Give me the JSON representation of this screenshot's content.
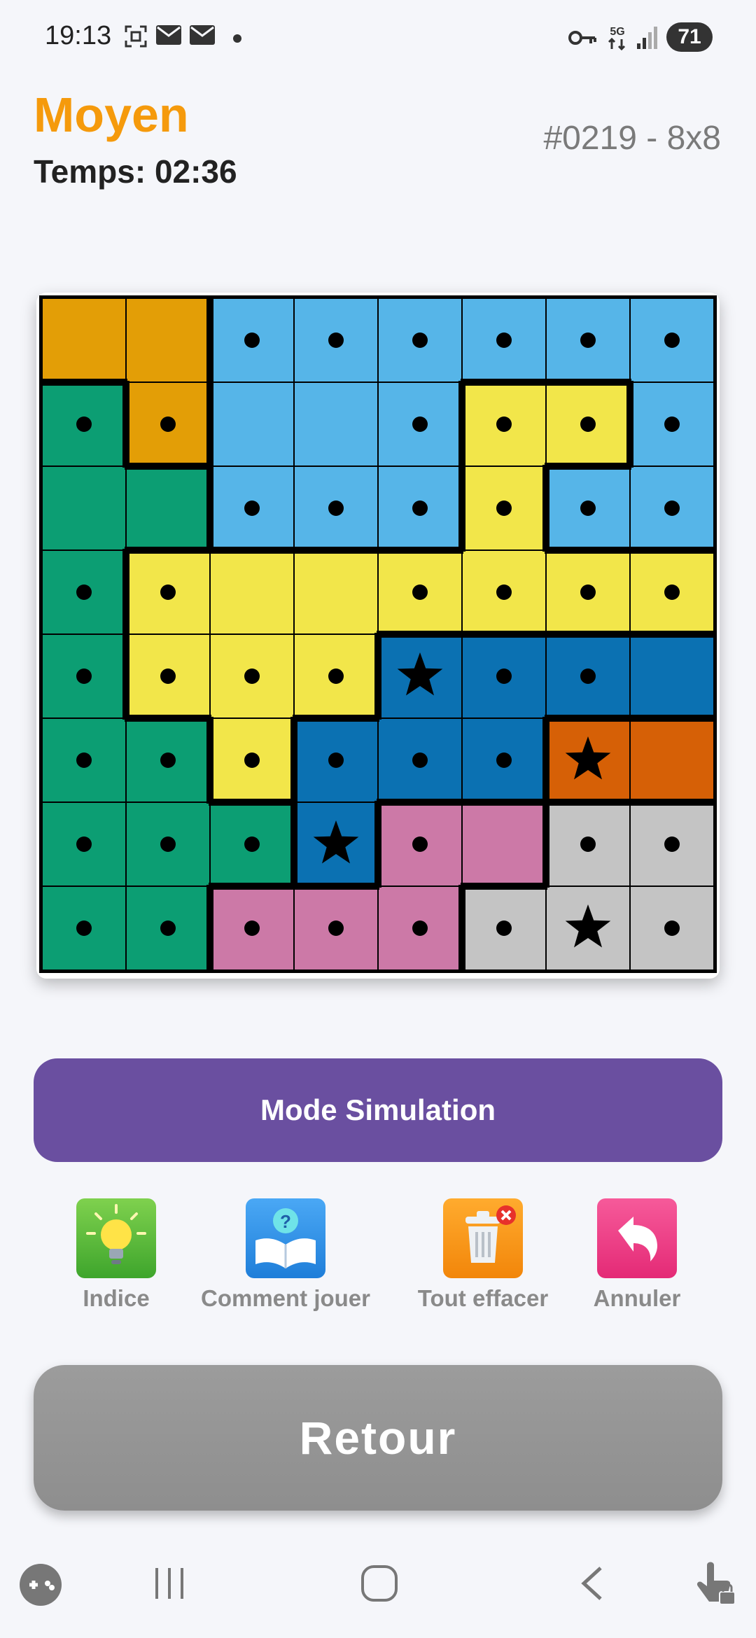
{
  "status_bar": {
    "time": "19:13",
    "battery": "71",
    "network": "5G"
  },
  "header": {
    "difficulty": "Moyen",
    "timer": "Temps: 02:36",
    "puzzle_id": "#0219 - 8x8"
  },
  "board": {
    "size": 8,
    "colors": {
      "O": "#e39e06",
      "L": "#56b5e8",
      "G": "#0c9e73",
      "Y": "#f2e64a",
      "B": "#0b71b2",
      "R": "#d66006",
      "P": "#cc79a7",
      "S": "#c4c4c4"
    },
    "regions": [
      "OOLLLLLL",
      "GOLLLYYL",
      "GGLLLYLL",
      "GYYYYYYY",
      "GYYYBBBB",
      "GGYBBBRR",
      "GGGBPPSS",
      "GGPPPSSS"
    ],
    "marks": [
      "__ddddd d",
      "dd__dddd",
      "__dddddd",
      "dd__dddd",
      "ddddds dd",
      "dddddd ds",
      "ddddsddd",
      "ddddddsd"
    ],
    "marks_clean": [
      "..dddddd",
      "dd..dddd",
      "..dddddd",
      "dd..dddd",
      "ddddsdd.",
      "dddddds.",
      "dddsd.dd",
      "ddddddsd"
    ]
  },
  "buttons": {
    "simulation": "Mode Simulation",
    "back": "Retour"
  },
  "tools": [
    {
      "label": "Indice",
      "icon": "lightbulb-icon",
      "color": "#5cbf3f"
    },
    {
      "label": "Comment jouer",
      "icon": "book-icon",
      "color": "#2e8fe8"
    },
    {
      "label": "Tout effacer",
      "icon": "trash-icon",
      "color": "#f7950f"
    },
    {
      "label": "Annuler",
      "icon": "undo-icon",
      "color": "#ee3f84"
    }
  ],
  "nav_bar": {
    "icons": [
      "game-icon",
      "recents-icon",
      "home-icon",
      "back-icon",
      "touch-lock-icon"
    ]
  }
}
